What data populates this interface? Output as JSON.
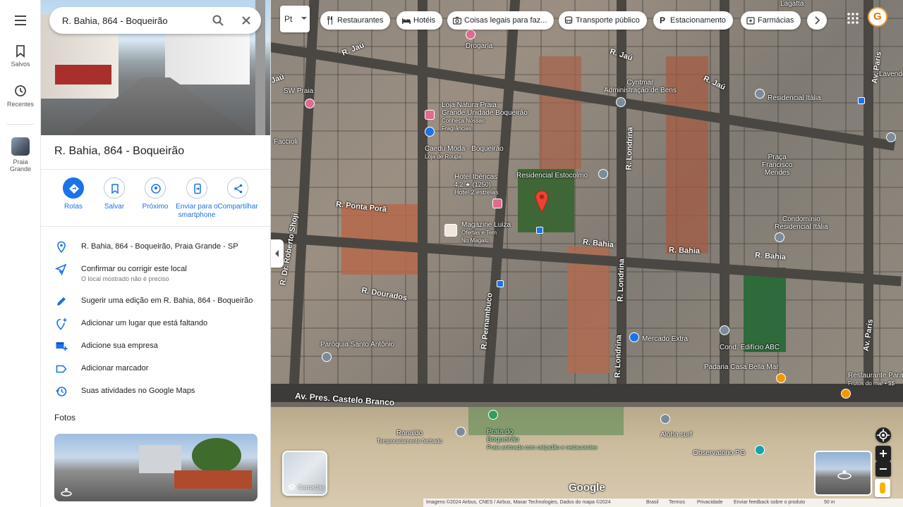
{
  "rail": {
    "saved_label": "Salvos",
    "recent_label": "Recentes",
    "place_label_1": "Praia",
    "place_label_2": "Grande"
  },
  "search": {
    "value": "R. Bahia, 864 - Boqueirão"
  },
  "place": {
    "title": "R. Bahia, 864 - Boqueirão",
    "actions": {
      "directions": "Rotas",
      "save": "Salvar",
      "nearby": "Próximo",
      "send_line1": "Enviar para o",
      "send_line2": "smartphone",
      "share": "Compartilhar"
    },
    "info": [
      {
        "text": "R. Bahia, 864 - Boqueirão, Praia Grande - SP"
      },
      {
        "text": "Confirmar ou corrigir este local",
        "sub": "O local mostrado não é preciso"
      },
      {
        "text": "Sugerir uma edição em R. Bahia, 864 - Boqueirão"
      },
      {
        "text": "Adicionar um lugar que está faltando"
      },
      {
        "text": "Adicione sua empresa"
      },
      {
        "text": "Adicionar marcador"
      },
      {
        "text": "Suas atividades no Google Maps"
      }
    ],
    "photos_title": "Fotos"
  },
  "map": {
    "mode_label": "Pt",
    "chips": [
      "Restaurantes",
      "Hotéis",
      "Coisas legais para faz...",
      "Transporte público",
      "Estacionamento",
      "Farmácias"
    ],
    "avatar_letter": "G",
    "layers_label": "Camadas",
    "google": "Google",
    "footer": {
      "credits": "Imagens ©2024 Airbus, CNES / Airbus, Maxar Technologies, Dados do mapa ©2024",
      "country": "Brasil",
      "terms": "Termos",
      "privacy": "Privacidade",
      "feedback": "Enviar feedback sobre o produto",
      "scale": "50 m"
    },
    "streets": {
      "jau1": "R. Jaú",
      "jau2": "R. Jaú",
      "jau3": "R. Jaú",
      "jau4": "Jaú",
      "ponta_pora": "R. Ponta Porã",
      "dourados": "R. Dourados",
      "bahia1": "R. Bahia",
      "bahia2": "R. Bahia",
      "bahia3": "R. Bahia",
      "pernambuco": "R. Pernambuco",
      "londrina1": "R. Londrina",
      "londrina2": "R. Londrina",
      "londrina3": "R. Londrina",
      "paris1": "Av. Paris",
      "paris2": "Av. Paris",
      "roberto": "R. Dr. Roberto Shoji",
      "castelo": "Av. Pres. Castelo Branco"
    },
    "pois": {
      "lagatta": "Lagatta",
      "drogaria": "Drogaria",
      "sw": "SW Praia",
      "faccioli": "Faccioli",
      "cyntmar_1": "Cyntmar",
      "cyntmar_2": "Administração de Bens",
      "natura_1": "Loja Natura Praia",
      "natura_2": "Grande Unidade Boqueirão",
      "natura_3": "Conheça Nossas",
      "natura_4": "Fragrâncias",
      "caedu_1": "Caedu Moda - Boqueirão",
      "caedu_2": "Loja de Roupa",
      "hotel_1": "Hotel Ibéricas",
      "hotel_2": "4,2 ★ (1250)",
      "hotel_3": "Hotel 2 estrelas",
      "estocolmo": "Residencial Estocolmo",
      "magazine_1": "Magazine Luiza",
      "magazine_2": "Ofertas e Tem",
      "magazine_3": "No Magalu",
      "italia": "Residencial Itália",
      "lavender": "Lavender",
      "praca_1": "Praça",
      "praca_2": "Francisco",
      "praca_3": "Mendes",
      "condominio_1": "Condomínio",
      "condominio_2": "Residencial Itália",
      "paroquia": "Paróquia Santo Antônio",
      "mercado": "Mercado Extra",
      "abc": "Cond. Edifício ABC",
      "padaria": "Padaria Casa Bella Mar",
      "restaurante_1": "Restaurante Paraí",
      "restaurante_2": "Frutos do mar • $$",
      "ronaldo_1": "Ronaldo",
      "ronaldo_2": "Temporariamente fechado",
      "praia_1": "Praia do",
      "praia_2": "Boqueirão",
      "praia_3": "Praia animada com calçadão e restaurantes",
      "aloha": "Aloha surf",
      "observatorio": "Observatório PG"
    },
    "colors": {
      "blue_pin": "#1a73e8",
      "pink_pin": "#e06b8e",
      "gray_pin": "#7c8b99",
      "green_pin": "#2f9e5a",
      "orange_pin": "#f29900",
      "teal_pin": "#12a4a8",
      "red_marker": "#ea4335"
    }
  }
}
